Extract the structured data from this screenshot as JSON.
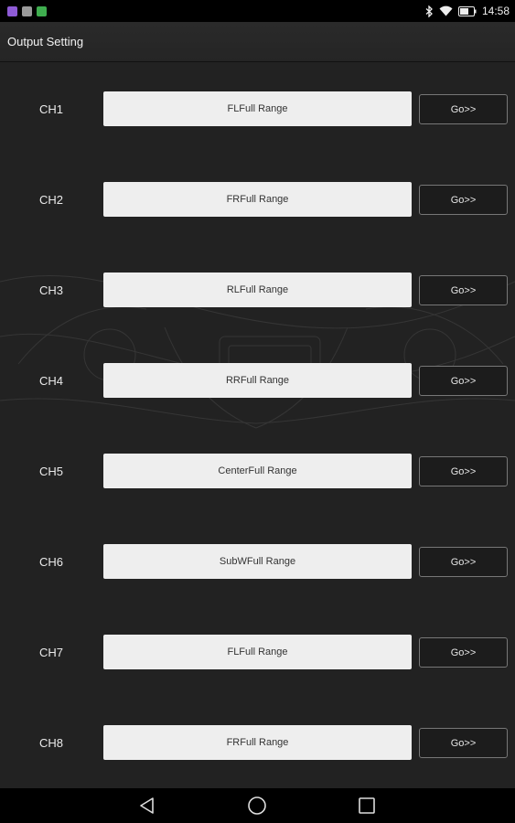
{
  "status_bar": {
    "time": "14:58",
    "notification_icons": [
      {
        "name": "app-notification-purple-icon",
        "color": "#8e5bd6"
      },
      {
        "name": "app-notification-gray-icon",
        "color": "#9a9a9a"
      },
      {
        "name": "app-notification-green-icon",
        "color": "#3fae4f"
      }
    ]
  },
  "app_bar": {
    "title": "Output Setting"
  },
  "channels": [
    {
      "label": "CH1",
      "value": "FLFull Range",
      "go": "Go>>"
    },
    {
      "label": "CH2",
      "value": "FRFull Range",
      "go": "Go>>"
    },
    {
      "label": "CH3",
      "value": "RLFull Range",
      "go": "Go>>"
    },
    {
      "label": "CH4",
      "value": "RRFull Range",
      "go": "Go>>"
    },
    {
      "label": "CH5",
      "value": "CenterFull Range",
      "go": "Go>>"
    },
    {
      "label": "CH6",
      "value": "SubWFull Range",
      "go": "Go>>"
    },
    {
      "label": "CH7",
      "value": "FLFull Range",
      "go": "Go>>"
    },
    {
      "label": "CH8",
      "value": "FRFull Range",
      "go": "Go>>"
    }
  ],
  "colors": {
    "background": "#222222",
    "range_box": "#eeeeee",
    "go_border": "#777777"
  }
}
